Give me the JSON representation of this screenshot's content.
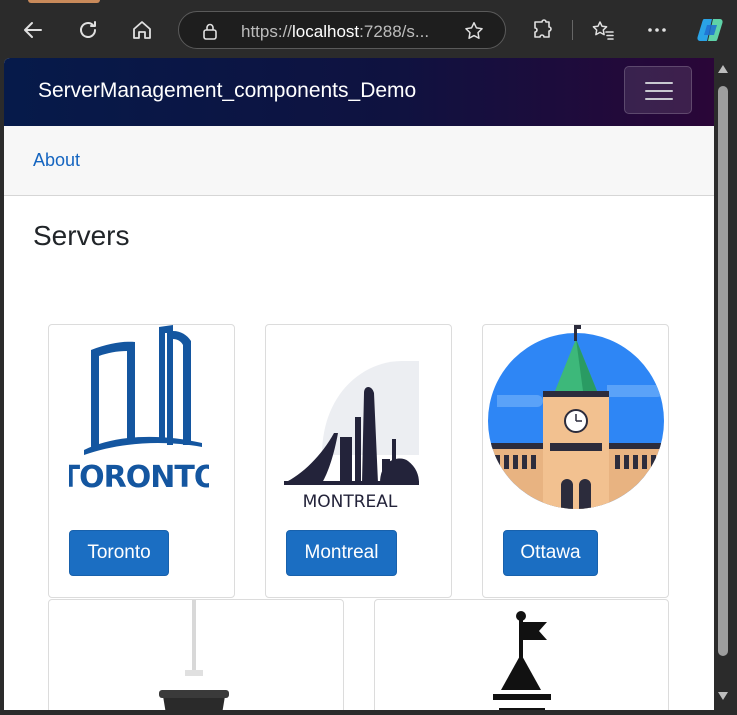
{
  "browser": {
    "url_prefix": "https://",
    "url_host": "localhost",
    "url_rest": ":7288/s..."
  },
  "app": {
    "brand": "ServerManagement_components_Demo"
  },
  "nav": {
    "about_label": "About"
  },
  "page": {
    "title": "Servers"
  },
  "servers": [
    {
      "name": "Toronto",
      "logo_text": "TORONTO"
    },
    {
      "name": "Montreal",
      "logo_text": "MONTREAL"
    },
    {
      "name": "Ottawa"
    }
  ],
  "colors": {
    "accent": "#1b6ec2",
    "link": "#1565c0",
    "navbar_start": "#061a4a",
    "navbar_end": "#2a0638"
  }
}
